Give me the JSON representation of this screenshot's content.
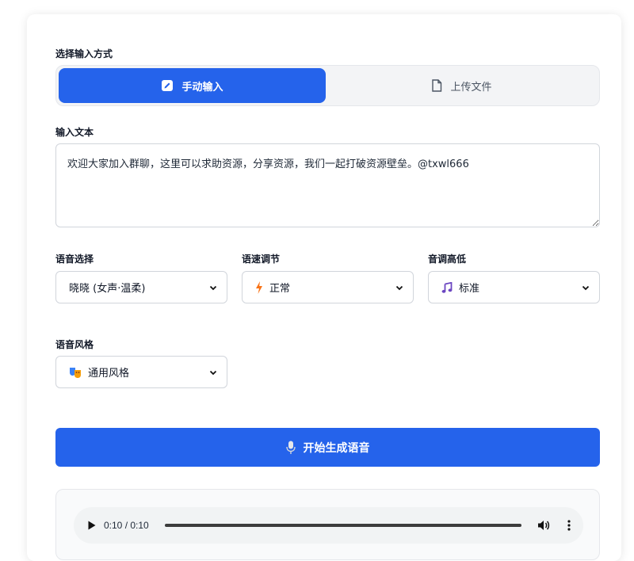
{
  "input_mode": {
    "label": "选择输入方式",
    "options": [
      {
        "label": "手动输入",
        "icon": "pencil-icon",
        "active": true
      },
      {
        "label": "上传文件",
        "icon": "file-icon",
        "active": false
      }
    ]
  },
  "text_input": {
    "label": "输入文本",
    "value": "欢迎大家加入群聊，这里可以求助资源，分享资源，我们一起打破资源壁垒。@txwl666"
  },
  "voice": {
    "label": "语音选择",
    "selected": "晓晓 (女声·温柔)"
  },
  "speed": {
    "label": "语速调节",
    "selected": "正常",
    "icon": "lightning-icon"
  },
  "pitch": {
    "label": "音调高低",
    "selected": "标准",
    "icon": "music-note-icon"
  },
  "style": {
    "label": "语音风格",
    "selected": "通用风格",
    "icon": "theater-masks-icon"
  },
  "generate_button": {
    "label": "开始生成语音",
    "icon": "microphone-icon"
  },
  "audio": {
    "time": "0:10 / 0:10",
    "progress": 1.0
  },
  "colors": {
    "accent": "#2563eb",
    "page_bg": "#ffffff",
    "muted_bg": "#f3f4f6"
  }
}
